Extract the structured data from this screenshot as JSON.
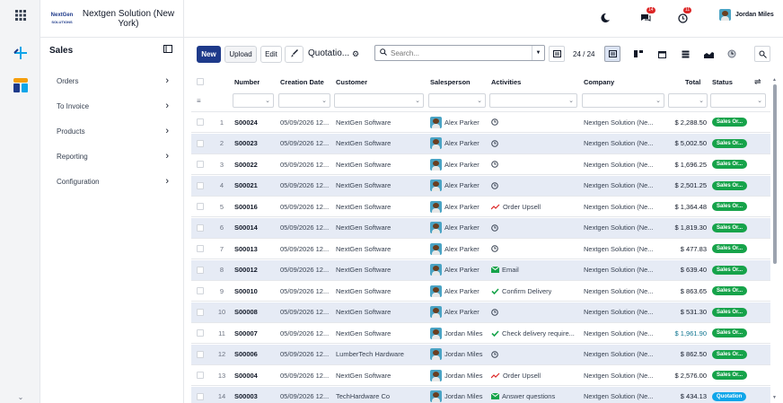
{
  "rail": {
    "icons": [
      "grid-icon",
      "plus-minus-icon",
      "layers-icon",
      "chevron-down-icon"
    ]
  },
  "brand": {
    "logo_text": "NextGen",
    "logo_sub": "SOLUTIONS",
    "company": "Nextgen Solution (New York)"
  },
  "topbar": {
    "chat_count": "14",
    "activity_count": "11",
    "user_name": "Jordan Miles"
  },
  "sidebar": {
    "title": "Sales",
    "items": [
      {
        "label": "Orders"
      },
      {
        "label": "To Invoice"
      },
      {
        "label": "Products"
      },
      {
        "label": "Reporting"
      },
      {
        "label": "Configuration"
      }
    ]
  },
  "toolbar": {
    "new_label": "New",
    "upload_label": "Upload",
    "edit_label": "Edit",
    "view_title": "Quotatio...",
    "search_placeholder": "Search...",
    "pager": "24 / 24"
  },
  "table": {
    "headers": {
      "number": "Number",
      "creation_date": "Creation Date",
      "customer": "Customer",
      "salesperson": "Salesperson",
      "activities": "Activities",
      "company": "Company",
      "total": "Total",
      "status": "Status"
    },
    "rows": [
      {
        "idx": "1",
        "number": "S00024",
        "date": "05/09/2026 12...",
        "customer": "NextGen Software",
        "salesperson": "Alex Parker",
        "activity": "",
        "activity_icon": "clock-icon",
        "company": "Nextgen Solution (Ne...",
        "total": "$ 2,288.50",
        "status": "Sales Or..."
      },
      {
        "idx": "2",
        "number": "S00023",
        "date": "05/09/2026 12...",
        "customer": "NextGen Software",
        "salesperson": "Alex Parker",
        "activity": "",
        "activity_icon": "clock-icon",
        "company": "Nextgen Solution (Ne...",
        "total": "$ 5,002.50",
        "status": "Sales Or..."
      },
      {
        "idx": "3",
        "number": "S00022",
        "date": "05/09/2026 12...",
        "customer": "NextGen Software",
        "salesperson": "Alex Parker",
        "activity": "",
        "activity_icon": "clock-icon",
        "company": "Nextgen Solution (Ne...",
        "total": "$ 1,696.25",
        "status": "Sales Or..."
      },
      {
        "idx": "4",
        "number": "S00021",
        "date": "05/09/2026 12...",
        "customer": "NextGen Software",
        "salesperson": "Alex Parker",
        "activity": "",
        "activity_icon": "clock-icon",
        "company": "Nextgen Solution (Ne...",
        "total": "$ 2,501.25",
        "status": "Sales Or..."
      },
      {
        "idx": "5",
        "number": "S00016",
        "date": "05/09/2026 12...",
        "customer": "NextGen Software",
        "salesperson": "Alex Parker",
        "activity": "Order Upsell",
        "activity_icon": "trend-icon",
        "company": "Nextgen Solution (Ne...",
        "total": "$ 1,364.48",
        "status": "Sales Or..."
      },
      {
        "idx": "6",
        "number": "S00014",
        "date": "05/09/2026 12...",
        "customer": "NextGen Software",
        "salesperson": "Alex Parker",
        "activity": "",
        "activity_icon": "clock-icon",
        "company": "Nextgen Solution (Ne...",
        "total": "$ 1,819.30",
        "status": "Sales Or..."
      },
      {
        "idx": "7",
        "number": "S00013",
        "date": "05/09/2026 12...",
        "customer": "NextGen Software",
        "salesperson": "Alex Parker",
        "activity": "",
        "activity_icon": "clock-icon",
        "company": "Nextgen Solution (Ne...",
        "total": "$ 477.83",
        "status": "Sales Or..."
      },
      {
        "idx": "8",
        "number": "S00012",
        "date": "05/09/2026 12...",
        "customer": "NextGen Software",
        "salesperson": "Alex Parker",
        "activity": "Email",
        "activity_icon": "email-icon",
        "company": "Nextgen Solution (Ne...",
        "total": "$ 639.40",
        "status": "Sales Or..."
      },
      {
        "idx": "9",
        "number": "S00010",
        "date": "05/09/2026 12...",
        "customer": "NextGen Software",
        "salesperson": "Alex Parker",
        "activity": "Confirm Delivery",
        "activity_icon": "check-icon",
        "company": "Nextgen Solution (Ne...",
        "total": "$ 863.65",
        "status": "Sales Or..."
      },
      {
        "idx": "10",
        "number": "S00008",
        "date": "05/09/2026 12...",
        "customer": "NextGen Software",
        "salesperson": "Alex Parker",
        "activity": "",
        "activity_icon": "clock-icon",
        "company": "Nextgen Solution (Ne...",
        "total": "$ 531.30",
        "status": "Sales Or..."
      },
      {
        "idx": "11",
        "number": "S00007",
        "date": "05/09/2026 12...",
        "customer": "NextGen Software",
        "salesperson": "Jordan Miles",
        "activity": "Check delivery require...",
        "activity_icon": "check-icon",
        "company": "Nextgen Solution (Ne...",
        "total": "$ 1,961.90",
        "status": "Sales Or..."
      },
      {
        "idx": "12",
        "number": "S00006",
        "date": "05/09/2026 12...",
        "customer": "LumberTech Hardware",
        "salesperson": "Jordan Miles",
        "activity": "",
        "activity_icon": "clock-icon",
        "company": "Nextgen Solution (Ne...",
        "total": "$ 862.50",
        "status": "Sales Or..."
      },
      {
        "idx": "13",
        "number": "S00004",
        "date": "05/09/2026 12...",
        "customer": "NextGen Software",
        "salesperson": "Jordan Miles",
        "activity": "Order Upsell",
        "activity_icon": "trend-icon",
        "company": "Nextgen Solution (Ne...",
        "total": "$ 2,576.00",
        "status": "Sales Or..."
      },
      {
        "idx": "14",
        "number": "S00003",
        "date": "05/09/2026 12...",
        "customer": "TechHardware Co",
        "salesperson": "Jordan Miles",
        "activity": "Answer questions",
        "activity_icon": "email-icon",
        "company": "Nextgen Solution (Ne...",
        "total": "$ 434.13",
        "status": "Quotation"
      }
    ]
  },
  "colors": {
    "primary": "#1e3a8a",
    "status_green": "#16a34a",
    "status_blue": "#0ea5e9",
    "row_alt": "#e6ebf5",
    "teal_total": "#0e7490"
  }
}
